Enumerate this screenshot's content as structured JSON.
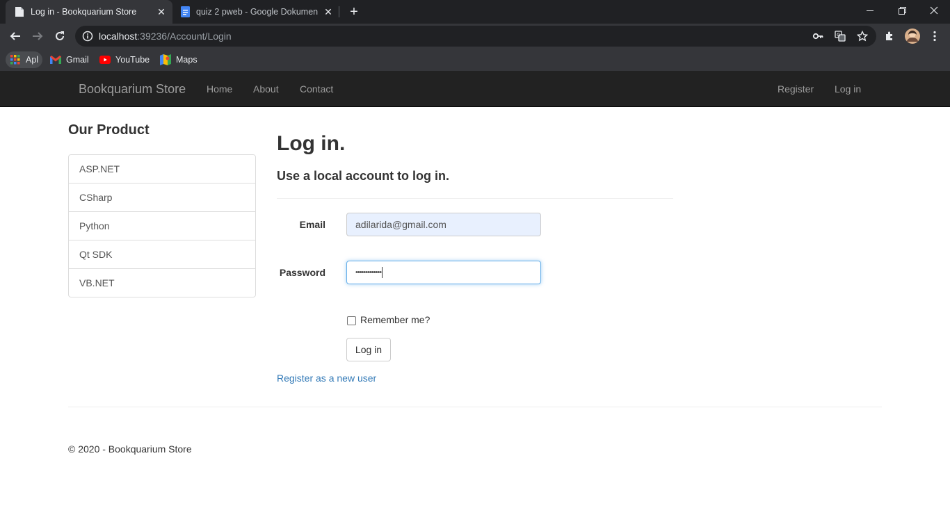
{
  "browser": {
    "tabs": [
      {
        "title": "Log in - Bookquarium Store",
        "active": true,
        "favicon": "page-icon"
      },
      {
        "title": "quiz 2 pweb - Google Dokumen",
        "active": false,
        "favicon": "google-docs-icon"
      }
    ],
    "url": {
      "host": "localhost",
      "rest": ":39236/Account/Login"
    },
    "bookmarks": [
      {
        "label": "Apl",
        "icon": "apps-grid-icon"
      },
      {
        "label": "Gmail",
        "icon": "gmail-icon"
      },
      {
        "label": "YouTube",
        "icon": "youtube-icon"
      },
      {
        "label": "Maps",
        "icon": "maps-icon"
      }
    ]
  },
  "navbar": {
    "brand": "Bookquarium Store",
    "links": [
      "Home",
      "About",
      "Contact"
    ],
    "right_links": [
      "Register",
      "Log in"
    ]
  },
  "sidebar": {
    "title": "Our Product",
    "items": [
      "ASP.NET",
      "CSharp",
      "Python",
      "Qt SDK",
      "VB.NET"
    ]
  },
  "login": {
    "heading": "Log in.",
    "subheading": "Use a local account to log in.",
    "email_label": "Email",
    "email_value": "adilarida@gmail.com",
    "password_label": "Password",
    "password_mask": "•••••••••••••",
    "remember_label": "Remember me?",
    "remember_checked": false,
    "submit_label": "Log in",
    "register_link": "Register as a new user"
  },
  "footer": {
    "text": "© 2020 - Bookquarium Store"
  },
  "colors": {
    "navbar_bg": "#222222",
    "link": "#337ab7",
    "chrome_dark": "#202124",
    "chrome_toolbar": "#35363a"
  }
}
